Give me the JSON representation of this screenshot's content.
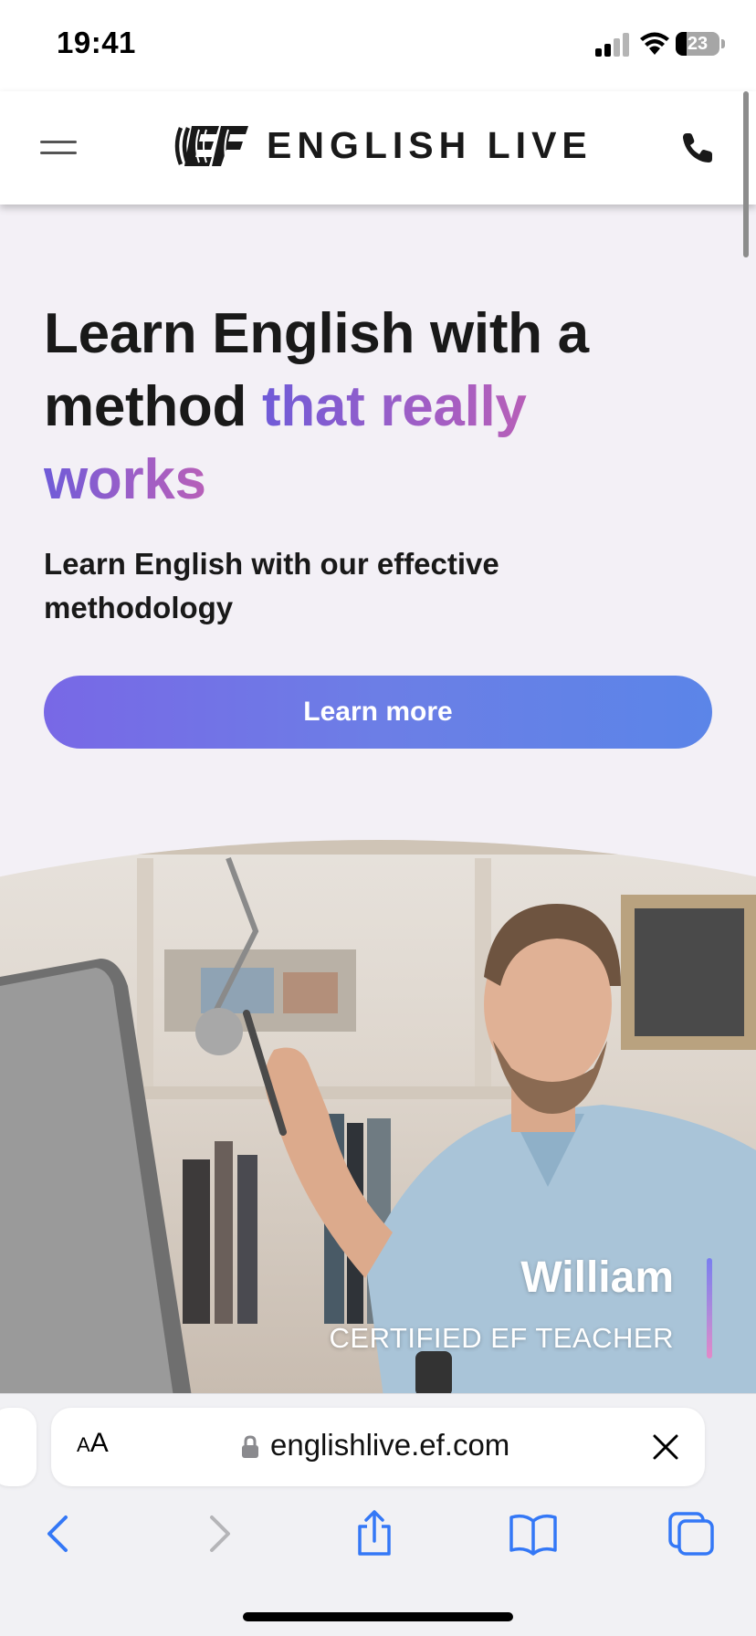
{
  "status_bar": {
    "time": "19:41",
    "battery_level": "23"
  },
  "header": {
    "brand": "ENGLISH LIVE"
  },
  "hero": {
    "title_line1": "Learn English with a",
    "title_line2_plain": "method ",
    "title_line2_accent": "that really",
    "title_line3_accent": "works",
    "subtitle": "Learn English with our effective methodology",
    "cta_label": "Learn more"
  },
  "teacher": {
    "name": "William",
    "role": "CERTIFIED EF TEACHER"
  },
  "browser": {
    "text_size_small": "A",
    "text_size_big": "A",
    "url": "englishlive.ef.com"
  },
  "colors": {
    "accent_purple": "#7868e6",
    "accent_blue": "#5b85e8",
    "accent_pink": "#b75fb8",
    "ios_blue": "#3478f6",
    "page_bg": "#f3f0f6"
  },
  "icons": {
    "menu": "hamburger-icon",
    "phone": "phone-icon",
    "lock": "lock-icon",
    "close": "close-icon",
    "back": "chevron-left-icon",
    "forward": "chevron-right-icon",
    "share": "share-icon",
    "bookmarks": "book-icon",
    "tabs": "tabs-icon"
  }
}
